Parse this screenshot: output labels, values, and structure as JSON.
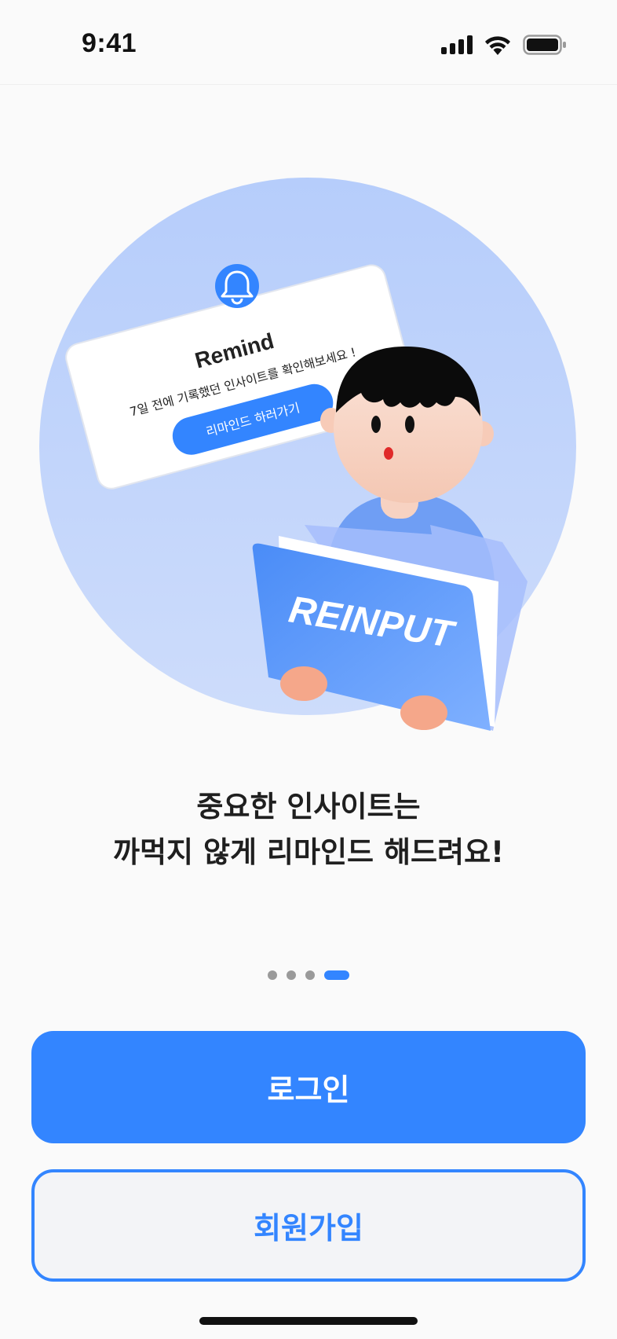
{
  "status_bar": {
    "time": "9:41"
  },
  "illustration": {
    "card_title": "Remind",
    "card_message": "7일 전에 기록했던 인사이트를 확인해보세요 !",
    "card_button": "리마인드 하러가기",
    "folder_text": "REINPUT"
  },
  "title": {
    "line1": "중요한 인사이트는",
    "line2": "까먹지 않게 리마인드 해드려요!"
  },
  "pager": {
    "total": 4,
    "active_index": 3
  },
  "buttons": {
    "login_label": "로그인",
    "signup_label": "회원가입"
  },
  "colors": {
    "accent": "#3385ff",
    "circle": "#bcd2fb"
  }
}
